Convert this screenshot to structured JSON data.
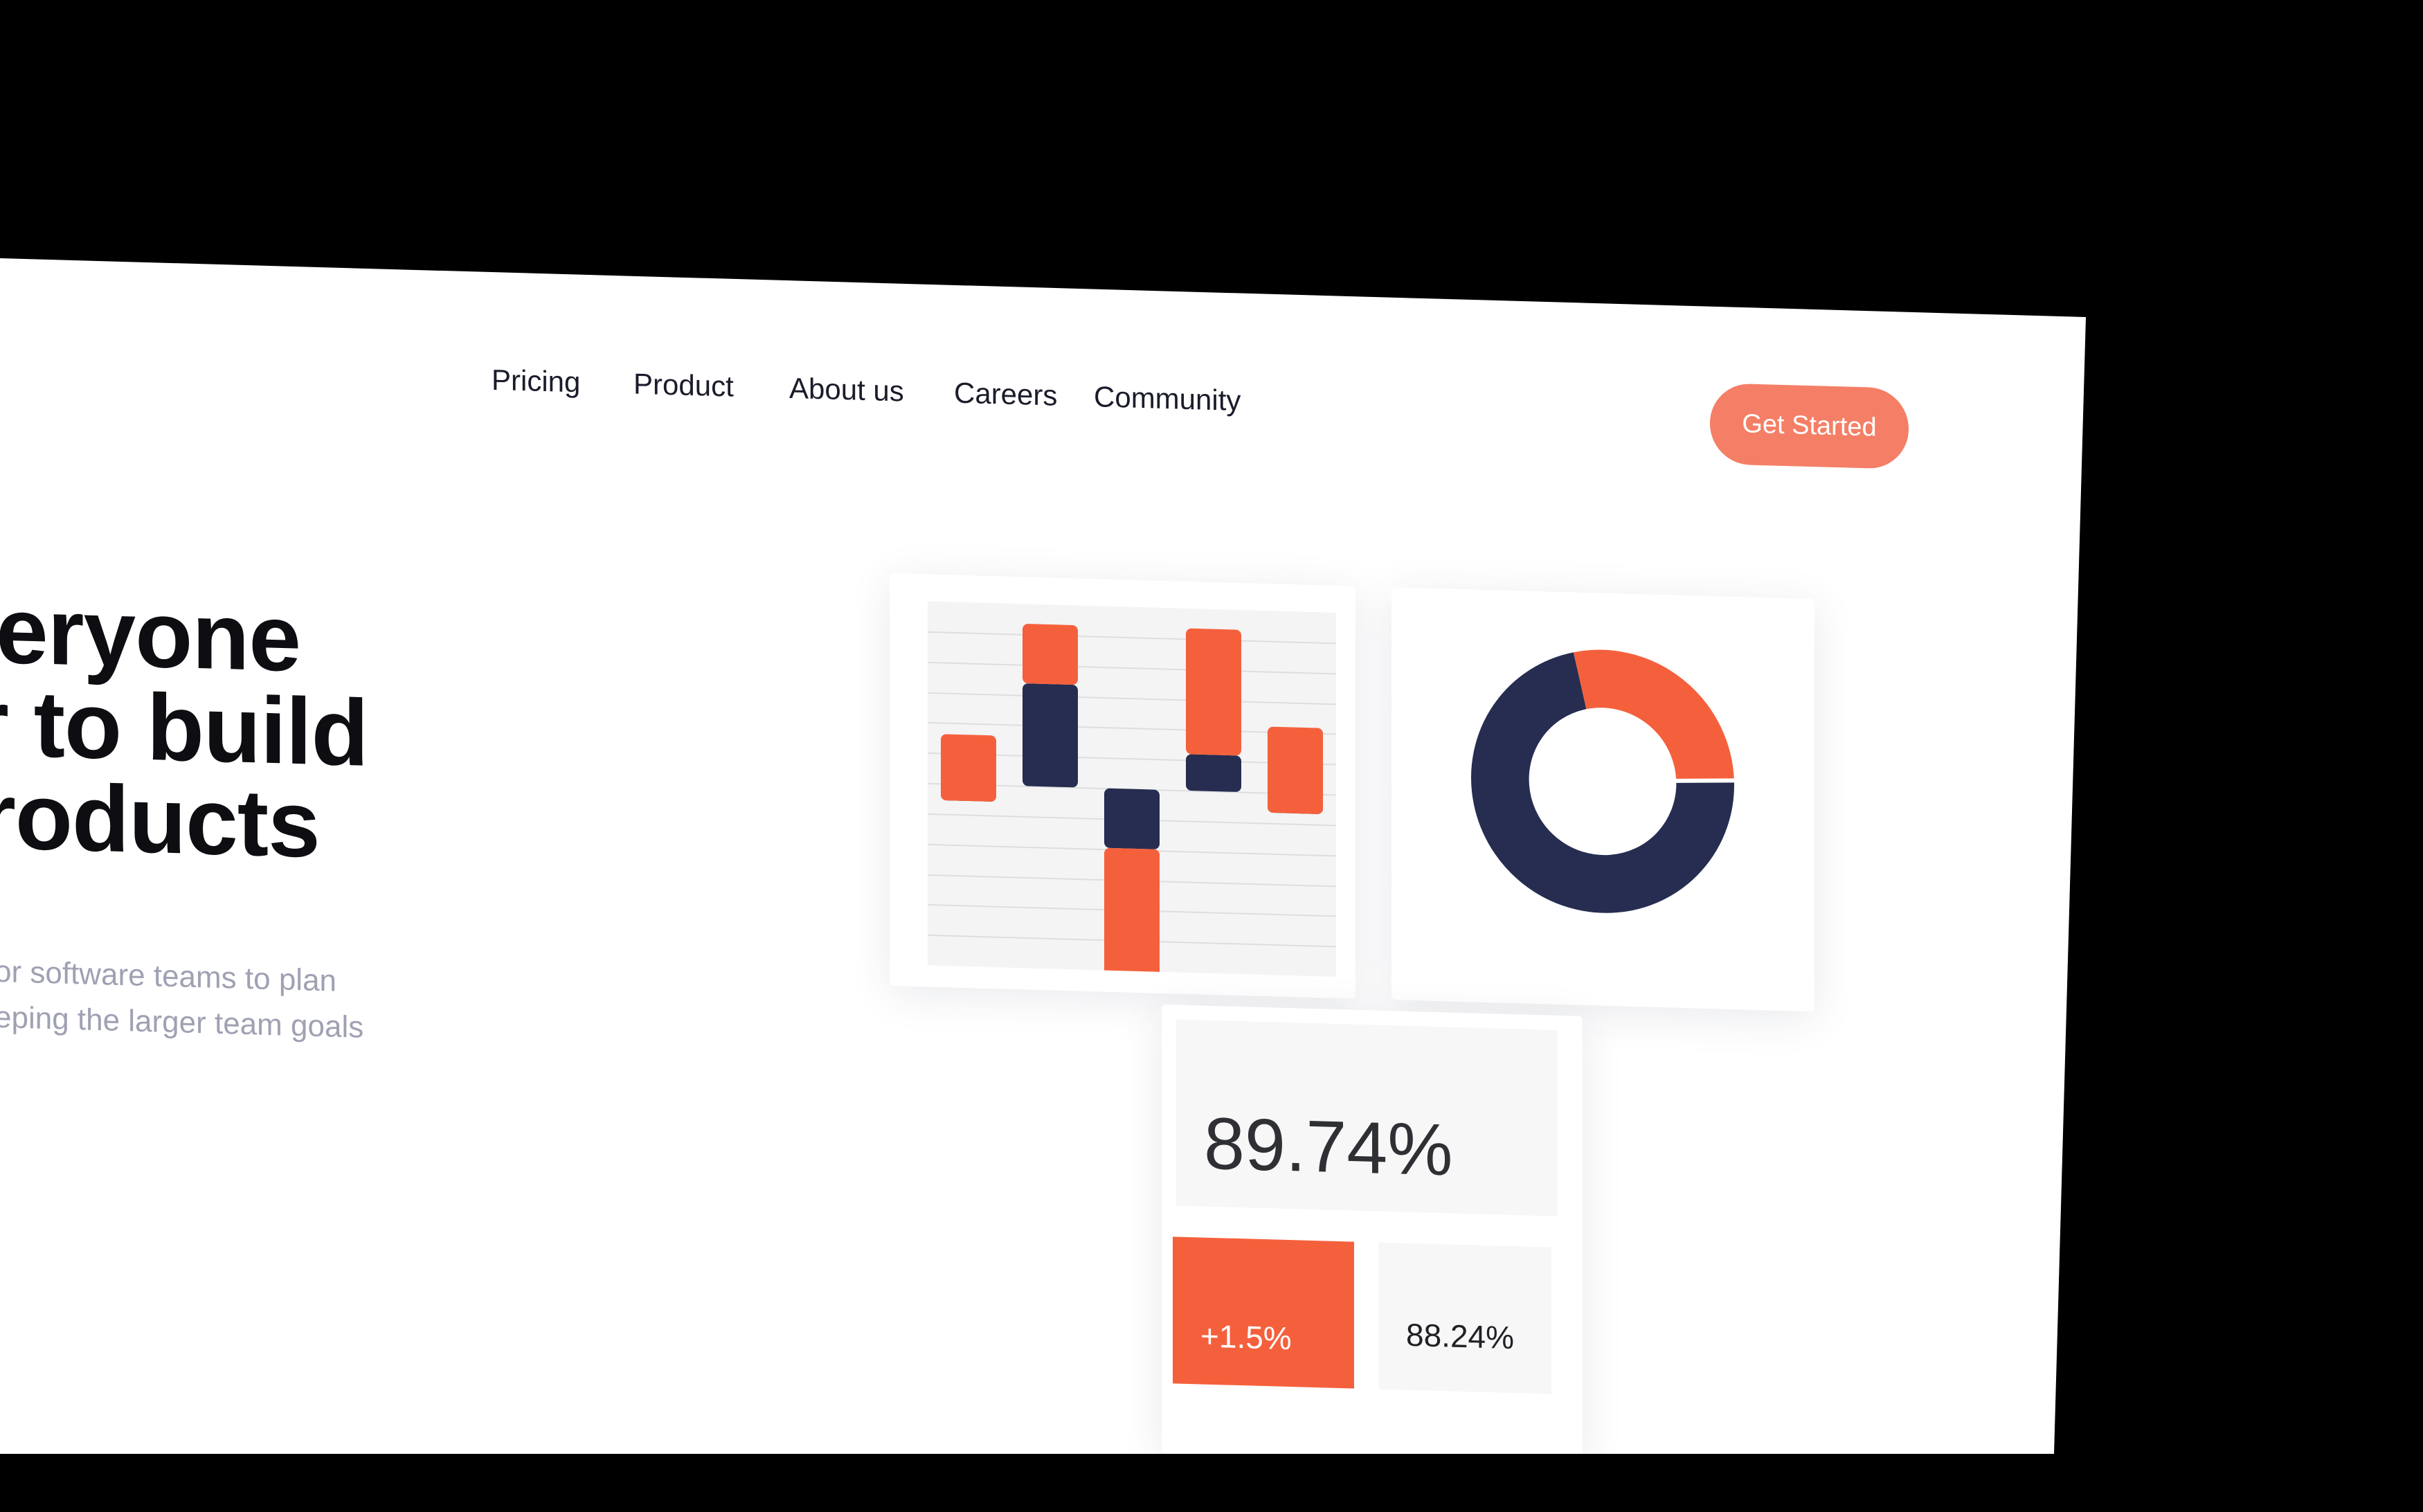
{
  "nav": {
    "links": [
      "Pricing",
      "Product",
      "About us",
      "Careers",
      "Community"
    ],
    "cta_label": "Get Started"
  },
  "hero": {
    "lines": [
      "eryone",
      "r to build",
      "roducts"
    ],
    "subtitle_lines": [
      "or software teams to plan",
      "eping the larger team goals"
    ]
  },
  "stats": {
    "main_value": "89.74%",
    "change_value": "+1.5%",
    "secondary_value": "88.24%"
  },
  "colors": {
    "navy": "#262d51",
    "orange": "#f5603c",
    "cta": "#f47f66",
    "page_background": "#ffffff",
    "frame": "#000000"
  },
  "chart_data": [
    {
      "type": "bar",
      "categories": [
        "",
        "",
        "",
        "",
        ""
      ],
      "series": [
        {
          "values": [
            -0.5,
            3.1,
            -1.8,
            1.1,
            -0.6
          ]
        },
        {
          "values": [
            2.0,
            1.8,
            -4.5,
            3.8,
            2.6
          ]
        }
      ],
      "ylim": [
        -5.5,
        5.5
      ],
      "grid": true,
      "colors": [
        "#262d51",
        "#f5603c"
      ]
    },
    {
      "type": "pie",
      "values": [
        72,
        28
      ],
      "colors": [
        "#262d51",
        "#f5603c"
      ],
      "hole": 0.4
    }
  ]
}
